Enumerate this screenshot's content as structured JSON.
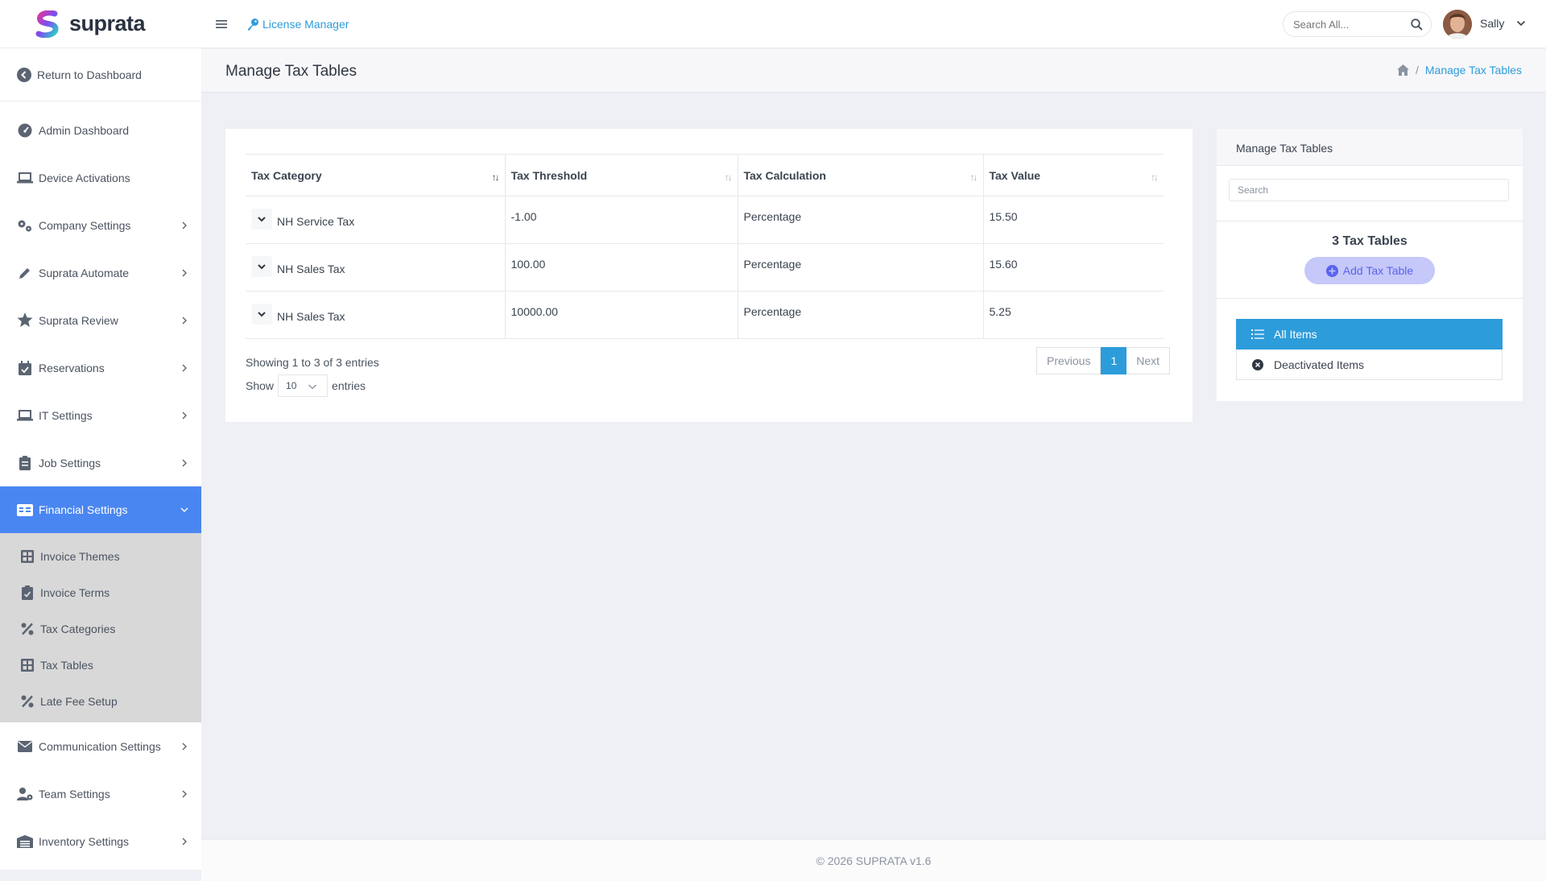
{
  "brand": {
    "name": "suprata"
  },
  "sidebar": {
    "return_label": "Return to Dashboard",
    "items": [
      {
        "label": "Admin Dashboard",
        "icon": "gauge-icon"
      },
      {
        "label": "Device Activations",
        "icon": "laptop-icon"
      },
      {
        "label": "Company Settings",
        "icon": "gears-icon"
      },
      {
        "label": "Suprata Automate",
        "icon": "pen-icon"
      },
      {
        "label": "Suprata Review",
        "icon": "star-icon"
      },
      {
        "label": "Reservations",
        "icon": "calendar-check-icon"
      },
      {
        "label": "IT Settings",
        "icon": "laptop-icon"
      },
      {
        "label": "Job Settings",
        "icon": "clipboard-icon"
      },
      {
        "label": "Financial Settings",
        "icon": "money-check-icon"
      }
    ],
    "subitems": [
      {
        "label": "Invoice Themes",
        "icon": "grid-icon"
      },
      {
        "label": "Invoice Terms",
        "icon": "clipboard-check-icon"
      },
      {
        "label": "Tax Categories",
        "icon": "percent-icon"
      },
      {
        "label": "Tax Tables",
        "icon": "table-icon"
      },
      {
        "label": "Late Fee Setup",
        "icon": "percent-icon"
      }
    ],
    "items_after": [
      {
        "label": "Communication Settings",
        "icon": "envelope-icon"
      },
      {
        "label": "Team Settings",
        "icon": "user-gear-icon"
      },
      {
        "label": "Inventory Settings",
        "icon": "warehouse-icon"
      }
    ]
  },
  "topbar": {
    "license_label": "License Manager",
    "search_placeholder": "Search All...",
    "user_name": "Sally"
  },
  "page": {
    "title": "Manage Tax Tables",
    "breadcrumb_current": "Manage Tax Tables"
  },
  "table": {
    "columns": [
      "Tax Category",
      "Tax Threshold",
      "Tax Calculation",
      "Tax Value"
    ],
    "rows": [
      {
        "category": "NH Service Tax",
        "threshold": "-1.00",
        "calculation": "Percentage",
        "value": "15.50"
      },
      {
        "category": "NH Sales Tax",
        "threshold": "100.00",
        "calculation": "Percentage",
        "value": "15.60"
      },
      {
        "category": "NH Sales Tax",
        "threshold": "10000.00",
        "calculation": "Percentage",
        "value": "5.25"
      }
    ],
    "showing": "Showing 1 to 3 of 3 entries",
    "show_label": "Show",
    "page_size": "10",
    "entries_label": "entries",
    "prev": "Previous",
    "current_page": "1",
    "next": "Next"
  },
  "panel": {
    "title": "Manage Tax Tables",
    "search_placeholder": "Search",
    "count": "3 Tax Tables",
    "add_label": "Add Tax Table",
    "filters": [
      {
        "label": "All Items",
        "active": true
      },
      {
        "label": "Deactivated Items",
        "active": false
      }
    ]
  },
  "footer": {
    "text": "© 2026 SUPRATA v1.6"
  },
  "colors": {
    "accent": "#2d9cdb",
    "active_nav": "#4a86f1",
    "add_button_bg": "#c5c8f8"
  }
}
